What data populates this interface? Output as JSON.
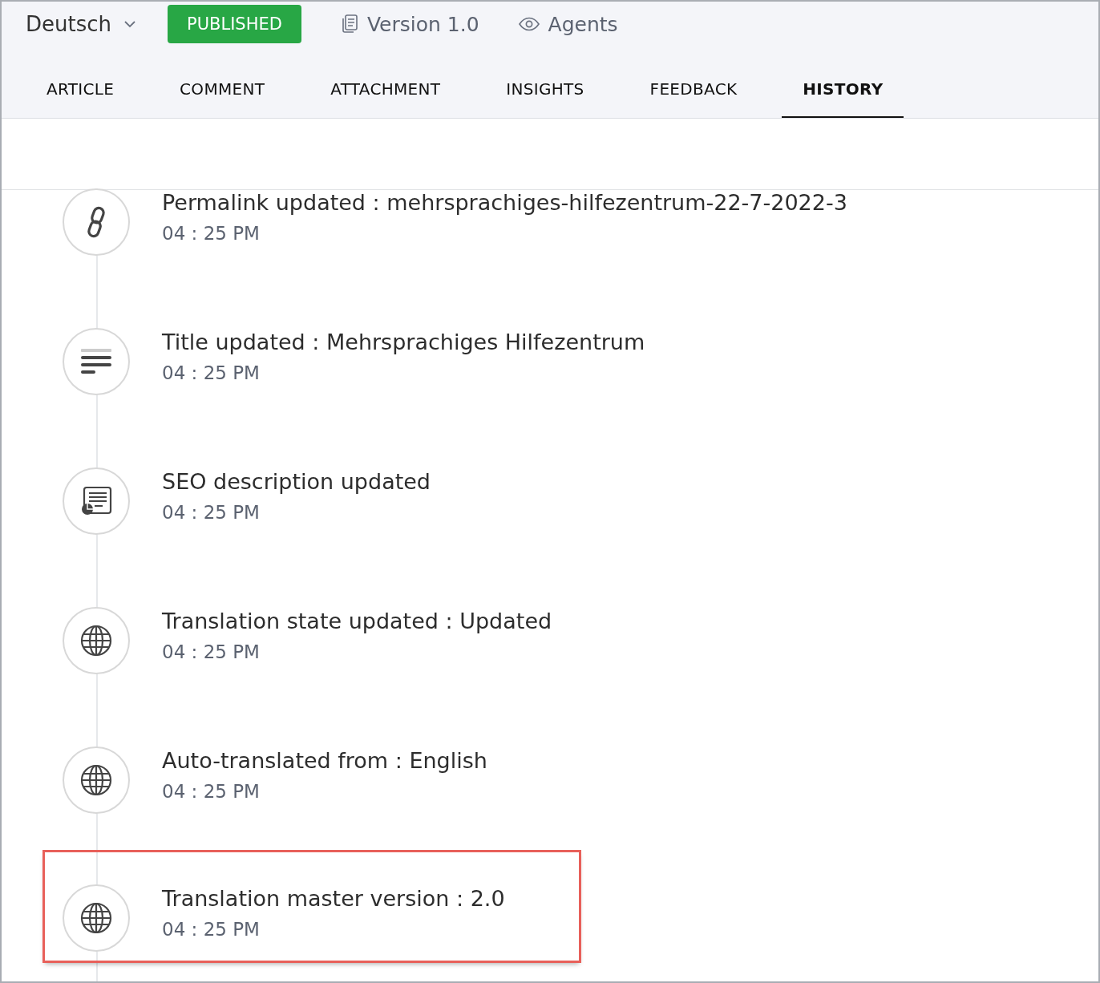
{
  "language": {
    "label": "Deutsch"
  },
  "status": {
    "label": "PUBLISHED"
  },
  "version": {
    "label": "Version 1.0"
  },
  "visibility": {
    "label": "Agents"
  },
  "tabs": [
    {
      "label": "ARTICLE",
      "selected": false
    },
    {
      "label": "COMMENT",
      "selected": false
    },
    {
      "label": "ATTACHMENT",
      "selected": false
    },
    {
      "label": "INSIGHTS",
      "selected": false
    },
    {
      "label": "FEEDBACK",
      "selected": false
    },
    {
      "label": "HISTORY",
      "selected": true
    }
  ],
  "history": [
    {
      "kind": "link",
      "text": "Permalink updated : mehrsprachiges-hilfezentrum-22-7-2022-3",
      "time": "04 : 25 PM",
      "highlighted": false
    },
    {
      "kind": "title",
      "text": "Title updated : Mehrsprachiges Hilfezentrum",
      "time": "04 : 25 PM",
      "highlighted": false
    },
    {
      "kind": "seo",
      "text": "SEO description updated",
      "time": "04 : 25 PM",
      "highlighted": false
    },
    {
      "kind": "translation",
      "text": "Translation state updated : Updated",
      "time": "04 : 25 PM",
      "highlighted": false
    },
    {
      "kind": "translation",
      "text": "Auto-translated from : English",
      "time": "04 : 25 PM",
      "highlighted": false
    },
    {
      "kind": "translation",
      "text": "Translation master version : 2.0",
      "time": "04 : 25 PM",
      "highlighted": true
    }
  ]
}
